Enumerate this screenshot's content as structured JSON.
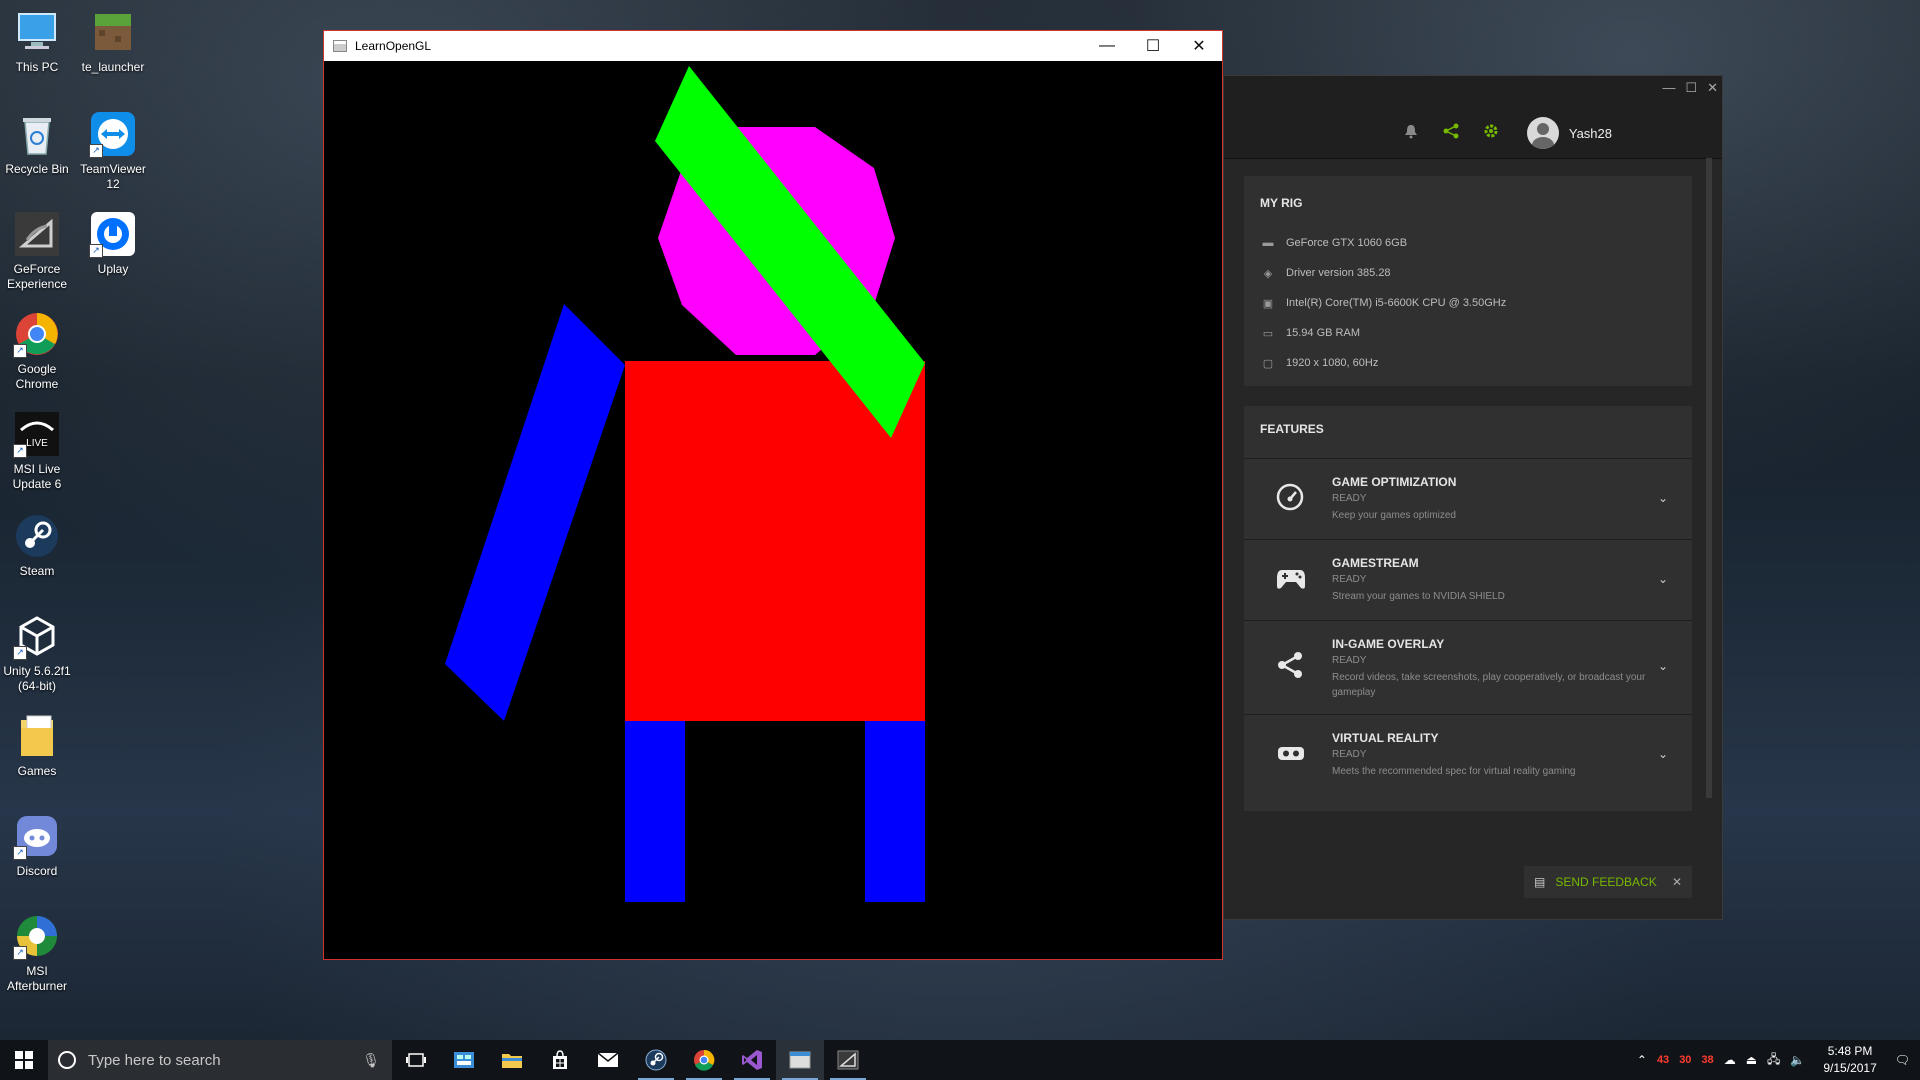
{
  "desktop": {
    "icons": [
      {
        "label": "This PC"
      },
      {
        "label": "te_launcher"
      },
      {
        "label": "Recycle Bin"
      },
      {
        "label": "TeamViewer 12"
      },
      {
        "label": "GeForce Experience"
      },
      {
        "label": "Uplay"
      },
      {
        "label": "Google Chrome"
      },
      {
        "label": "MSI Live Update 6"
      },
      {
        "label": "Steam"
      },
      {
        "label": "Unity 5.6.2f1 (64-bit)"
      },
      {
        "label": "Games"
      },
      {
        "label": "Discord"
      },
      {
        "label": "MSI Afterburner"
      }
    ]
  },
  "gl_window": {
    "title": "LearnOpenGL",
    "buttons": {
      "minimize": "—",
      "maximize": "☐",
      "close": "✕"
    },
    "scene_colors": {
      "background": "#000000",
      "body": "#ff0000",
      "head": "#ff00ff",
      "band": "#00ff00",
      "limbs": "#0000ff"
    }
  },
  "gfe_window": {
    "window_buttons": {
      "minimize": "—",
      "maximize": "☐",
      "close": "✕"
    },
    "header_icons": [
      "bell-icon",
      "share-icon",
      "settings-icon"
    ],
    "accent_color": "#76b900",
    "username": "Yash28",
    "my_rig": {
      "title": "MY RIG",
      "items": [
        {
          "icon": "gpu-icon",
          "text": "GeForce GTX 1060 6GB"
        },
        {
          "icon": "driver-icon",
          "text": "Driver version 385.28"
        },
        {
          "icon": "cpu-icon",
          "text": "Intel(R) Core(TM) i5-6600K CPU @ 3.50GHz"
        },
        {
          "icon": "ram-icon",
          "text": "15.94 GB RAM"
        },
        {
          "icon": "monitor-icon",
          "text": "1920 x 1080, 60Hz"
        }
      ]
    },
    "features": {
      "title": "FEATURES",
      "items": [
        {
          "icon": "speedometer-icon",
          "name": "GAME OPTIMIZATION",
          "status": "READY",
          "desc": "Keep your games optimized"
        },
        {
          "icon": "gamepad-icon",
          "name": "GAMESTREAM",
          "status": "READY",
          "desc": "Stream your games to NVIDIA SHIELD"
        },
        {
          "icon": "share-icon",
          "name": "IN-GAME OVERLAY",
          "status": "READY",
          "desc": "Record videos, take screenshots, play cooperatively, or broadcast your gameplay"
        },
        {
          "icon": "vr-headset-icon",
          "name": "VIRTUAL REALITY",
          "status": "READY",
          "desc": "Meets the recommended spec for virtual reality gaming"
        }
      ]
    },
    "feedback": {
      "label": "SEND FEEDBACK",
      "close": "✕"
    }
  },
  "taskbar": {
    "search_placeholder": "Type here to search",
    "pinned": [
      "task-view",
      "control-panel",
      "file-explorer",
      "store",
      "mail",
      "steam",
      "chrome",
      "visual-studio",
      "learnopengl",
      "geforce-experience"
    ],
    "tray": {
      "temps": [
        "43",
        "30",
        "38"
      ],
      "time": "5:48 PM",
      "date": "9/15/2017"
    }
  }
}
